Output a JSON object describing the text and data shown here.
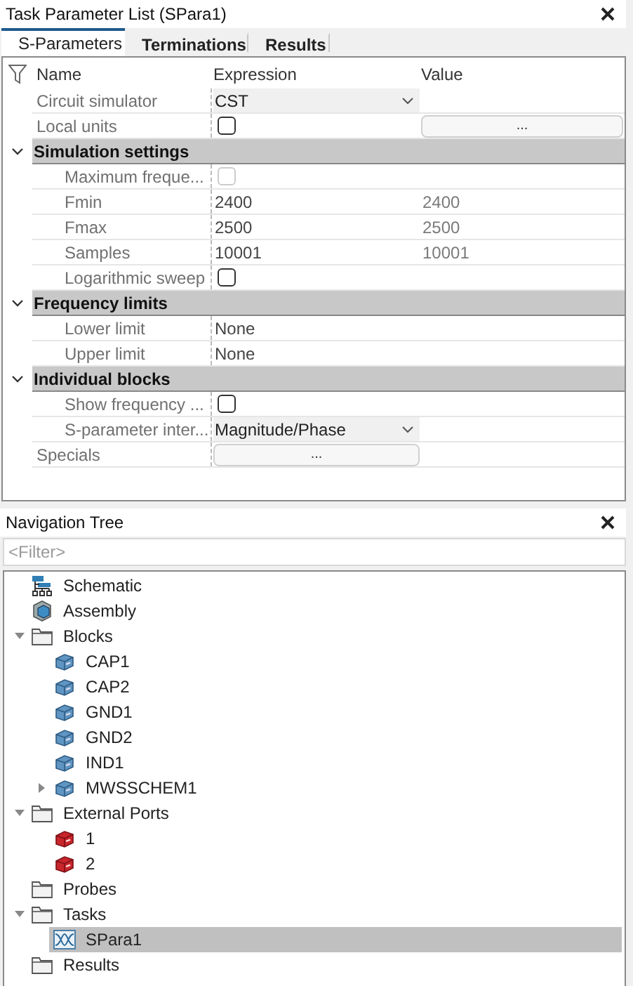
{
  "parameter_panel": {
    "title": "Task Parameter List (SPara1)",
    "tabs": [
      {
        "label": "S-Parameters",
        "selected": true
      },
      {
        "label": "Terminations",
        "selected": false
      },
      {
        "label": "Results",
        "selected": false
      }
    ],
    "columns": [
      "Name",
      "Expression",
      "Value"
    ],
    "rows": [
      {
        "kind": "property",
        "name": "Circuit simulator",
        "expression": {
          "kind": "dropdown",
          "text": "CST"
        }
      },
      {
        "kind": "property",
        "name": "Local units",
        "expression": {
          "kind": "checkbox",
          "checked": false,
          "disabled": false
        },
        "value": {
          "kind": "button",
          "text": "..."
        }
      },
      {
        "kind": "group",
        "title": "Simulation settings",
        "expanded": true,
        "children": [
          {
            "kind": "property",
            "name": "Maximum freque...",
            "expression": {
              "kind": "checkbox",
              "checked": false,
              "disabled": true
            }
          },
          {
            "kind": "property",
            "name": "Fmin",
            "expression": {
              "kind": "text",
              "text": "2400"
            },
            "value": {
              "kind": "text",
              "text": "2400"
            }
          },
          {
            "kind": "property",
            "name": "Fmax",
            "expression": {
              "kind": "text",
              "text": "2500"
            },
            "value": {
              "kind": "text",
              "text": "2500"
            }
          },
          {
            "kind": "property",
            "name": "Samples",
            "expression": {
              "kind": "text",
              "text": "10001"
            },
            "value": {
              "kind": "text",
              "text": "10001"
            }
          },
          {
            "kind": "property",
            "name": "Logarithmic sweep",
            "expression": {
              "kind": "checkbox",
              "checked": false,
              "disabled": false
            }
          }
        ]
      },
      {
        "kind": "group",
        "title": "Frequency limits",
        "expanded": true,
        "children": [
          {
            "kind": "property",
            "name": "Lower limit",
            "expression": {
              "kind": "text",
              "text": "None"
            }
          },
          {
            "kind": "property",
            "name": "Upper limit",
            "expression": {
              "kind": "text",
              "text": "None"
            }
          }
        ]
      },
      {
        "kind": "group",
        "title": "Individual blocks",
        "expanded": true,
        "children": [
          {
            "kind": "property",
            "name": "Show frequency ...",
            "expression": {
              "kind": "checkbox",
              "checked": false,
              "disabled": false
            }
          },
          {
            "kind": "property",
            "name": "S-parameter inter...",
            "expression": {
              "kind": "dropdown",
              "text": "Magnitude/Phase"
            }
          }
        ]
      },
      {
        "kind": "property",
        "name": "Specials",
        "expression": {
          "kind": "button",
          "text": "..."
        }
      }
    ]
  },
  "navigation_tree": {
    "title": "Navigation Tree",
    "filter": {
      "placeholder": "<Filter>"
    },
    "items": [
      {
        "label": "Schematic",
        "kind": "schematic",
        "selected": false
      },
      {
        "label": "Assembly",
        "kind": "assembly",
        "selected": false
      },
      {
        "label": "Blocks",
        "kind": "folder",
        "selected": false,
        "expanded": true,
        "children": [
          {
            "label": "CAP1",
            "kind": "block",
            "selected": false
          },
          {
            "label": "CAP2",
            "kind": "block",
            "selected": false
          },
          {
            "label": "GND1",
            "kind": "block",
            "selected": false
          },
          {
            "label": "GND2",
            "kind": "block",
            "selected": false
          },
          {
            "label": "IND1",
            "kind": "block",
            "selected": false
          },
          {
            "label": "MWSSCHEM1",
            "kind": "block",
            "selected": false,
            "expanded": false
          }
        ]
      },
      {
        "label": "External Ports",
        "kind": "folder",
        "selected": false,
        "expanded": true,
        "children": [
          {
            "label": "1",
            "kind": "port",
            "selected": false
          },
          {
            "label": "2",
            "kind": "port",
            "selected": false
          }
        ]
      },
      {
        "label": "Probes",
        "kind": "folder",
        "selected": false
      },
      {
        "label": "Tasks",
        "kind": "folder",
        "selected": false,
        "expanded": true,
        "children": [
          {
            "label": "SPara1",
            "kind": "task",
            "selected": true
          }
        ]
      },
      {
        "label": "Results",
        "kind": "folder",
        "selected": false
      }
    ]
  }
}
